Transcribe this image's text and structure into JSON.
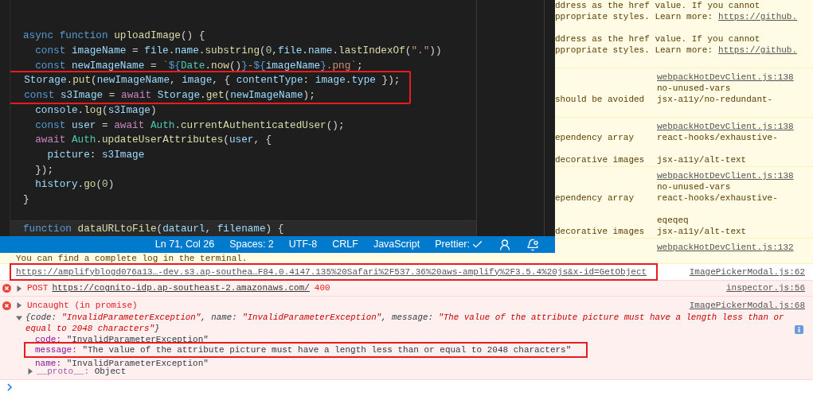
{
  "editor": {
    "lines": [
      {
        "kind": "blank",
        "highlighted": false,
        "current": false
      },
      {
        "kind": "blank",
        "highlighted": false,
        "current": false
      },
      {
        "kind": "code",
        "highlighted": false,
        "current": false,
        "tokens": [
          {
            "text": "async",
            "kind": "kw"
          },
          {
            "text": " function",
            "kind": "kw"
          },
          {
            "text": " uploadImage",
            "kind": "fn"
          },
          {
            "text": "() {",
            "kind": "plain"
          }
        ]
      },
      {
        "kind": "code",
        "highlighted": false,
        "current": false,
        "tokens": [
          {
            "text": "  const",
            "kind": "kw"
          },
          {
            "text": " imageName",
            "kind": "var"
          },
          {
            "text": " = ",
            "kind": "plain"
          },
          {
            "text": "file",
            "kind": "var"
          },
          {
            "text": ".",
            "kind": "plain"
          },
          {
            "text": "name",
            "kind": "var"
          },
          {
            "text": ".",
            "kind": "plain"
          },
          {
            "text": "substring",
            "kind": "fn"
          },
          {
            "text": "(",
            "kind": "plain"
          },
          {
            "text": "0",
            "kind": "num"
          },
          {
            "text": ",",
            "kind": "plain"
          },
          {
            "text": "file",
            "kind": "var"
          },
          {
            "text": ".",
            "kind": "plain"
          },
          {
            "text": "name",
            "kind": "var"
          },
          {
            "text": ".",
            "kind": "plain"
          },
          {
            "text": "lastIndexOf",
            "kind": "fn"
          },
          {
            "text": "(",
            "kind": "plain"
          },
          {
            "text": "\".\"",
            "kind": "str"
          },
          {
            "text": "))",
            "kind": "plain"
          }
        ]
      },
      {
        "kind": "code",
        "highlighted": false,
        "current": false,
        "tokens": [
          {
            "text": "  const",
            "kind": "kw"
          },
          {
            "text": " newImageName",
            "kind": "var"
          },
          {
            "text": " = ",
            "kind": "plain"
          },
          {
            "text": "`",
            "kind": "str"
          },
          {
            "text": "${",
            "kind": "kw"
          },
          {
            "text": "Date",
            "kind": "type"
          },
          {
            "text": ".",
            "kind": "plain"
          },
          {
            "text": "now",
            "kind": "fn"
          },
          {
            "text": "()",
            "kind": "plain"
          },
          {
            "text": "}",
            "kind": "kw"
          },
          {
            "text": "-",
            "kind": "str"
          },
          {
            "text": "${",
            "kind": "kw"
          },
          {
            "text": "imageName",
            "kind": "var"
          },
          {
            "text": "}",
            "kind": "kw"
          },
          {
            "text": ".png`",
            "kind": "str"
          },
          {
            "text": ";",
            "kind": "plain"
          }
        ]
      },
      {
        "kind": "code",
        "highlighted": true,
        "current": false,
        "tokens": [
          {
            "text": "  Storage",
            "kind": "var"
          },
          {
            "text": ".",
            "kind": "plain"
          },
          {
            "text": "put",
            "kind": "fn"
          },
          {
            "text": "(",
            "kind": "plain"
          },
          {
            "text": "newImageName",
            "kind": "var"
          },
          {
            "text": ", ",
            "kind": "plain"
          },
          {
            "text": "image",
            "kind": "var"
          },
          {
            "text": ", { ",
            "kind": "plain"
          },
          {
            "text": "contentType",
            "kind": "var"
          },
          {
            "text": ": ",
            "kind": "plain"
          },
          {
            "text": "image",
            "kind": "var"
          },
          {
            "text": ".",
            "kind": "plain"
          },
          {
            "text": "type",
            "kind": "var"
          },
          {
            "text": " });",
            "kind": "plain"
          }
        ]
      },
      {
        "kind": "code",
        "highlighted": true,
        "current": false,
        "tokens": [
          {
            "text": "  const",
            "kind": "kw"
          },
          {
            "text": " s3Image",
            "kind": "var"
          },
          {
            "text": " = ",
            "kind": "plain"
          },
          {
            "text": "await",
            "kind": "ctl"
          },
          {
            "text": " Storage",
            "kind": "var"
          },
          {
            "text": ".",
            "kind": "plain"
          },
          {
            "text": "get",
            "kind": "fn"
          },
          {
            "text": "(",
            "kind": "plain"
          },
          {
            "text": "newImageName",
            "kind": "var"
          },
          {
            "text": ");",
            "kind": "plain"
          }
        ]
      },
      {
        "kind": "code",
        "highlighted": false,
        "current": false,
        "tokens": [
          {
            "text": "  console",
            "kind": "var"
          },
          {
            "text": ".",
            "kind": "plain"
          },
          {
            "text": "log",
            "kind": "fn"
          },
          {
            "text": "(",
            "kind": "plain"
          },
          {
            "text": "s3Image",
            "kind": "var"
          },
          {
            "text": ")",
            "kind": "plain"
          }
        ]
      },
      {
        "kind": "code",
        "highlighted": false,
        "current": false,
        "tokens": [
          {
            "text": "  const",
            "kind": "kw"
          },
          {
            "text": " user",
            "kind": "var"
          },
          {
            "text": " = ",
            "kind": "plain"
          },
          {
            "text": "await",
            "kind": "ctl"
          },
          {
            "text": " Auth",
            "kind": "type"
          },
          {
            "text": ".",
            "kind": "plain"
          },
          {
            "text": "currentAuthenticatedUser",
            "kind": "fn"
          },
          {
            "text": "();",
            "kind": "plain"
          }
        ]
      },
      {
        "kind": "code",
        "highlighted": false,
        "current": false,
        "tokens": [
          {
            "text": "  await",
            "kind": "ctl"
          },
          {
            "text": " Auth",
            "kind": "type"
          },
          {
            "text": ".",
            "kind": "plain"
          },
          {
            "text": "updateUserAttributes",
            "kind": "fn"
          },
          {
            "text": "(",
            "kind": "plain"
          },
          {
            "text": "user",
            "kind": "var"
          },
          {
            "text": ", {",
            "kind": "plain"
          }
        ]
      },
      {
        "kind": "code",
        "highlighted": false,
        "current": false,
        "tokens": [
          {
            "text": "    picture",
            "kind": "var"
          },
          {
            "text": ": ",
            "kind": "plain"
          },
          {
            "text": "s3Image",
            "kind": "var"
          }
        ]
      },
      {
        "kind": "code",
        "highlighted": false,
        "current": false,
        "tokens": [
          {
            "text": "  });",
            "kind": "plain"
          }
        ]
      },
      {
        "kind": "code",
        "highlighted": false,
        "current": false,
        "tokens": [
          {
            "text": "  history",
            "kind": "var"
          },
          {
            "text": ".",
            "kind": "plain"
          },
          {
            "text": "go",
            "kind": "fn"
          },
          {
            "text": "(",
            "kind": "plain"
          },
          {
            "text": "0",
            "kind": "num"
          },
          {
            "text": ")",
            "kind": "plain"
          }
        ]
      },
      {
        "kind": "code",
        "highlighted": false,
        "current": false,
        "tokens": [
          {
            "text": "}",
            "kind": "plain"
          }
        ]
      },
      {
        "kind": "blank",
        "highlighted": false,
        "current": false
      },
      {
        "kind": "code",
        "highlighted": false,
        "current": true,
        "tokens": [
          {
            "text": "function",
            "kind": "kw"
          },
          {
            "text": " dataURLtoFile",
            "kind": "fn"
          },
          {
            "text": "(",
            "kind": "plain"
          },
          {
            "text": "dataurl",
            "kind": "var"
          },
          {
            "text": ", ",
            "kind": "plain"
          },
          {
            "text": "filename",
            "kind": "var"
          },
          {
            "text": ") {",
            "kind": "plain"
          }
        ]
      }
    ],
    "status_bar": [
      {
        "kind": "text",
        "text": "Ln 71, Col 26"
      },
      {
        "kind": "text",
        "text": "Spaces: 2"
      },
      {
        "kind": "text",
        "text": "UTF-8"
      },
      {
        "kind": "text",
        "text": "CRLF"
      },
      {
        "kind": "text",
        "text": "JavaScript"
      },
      {
        "kind": "checked",
        "text": "Prettier:"
      },
      {
        "kind": "feedback"
      },
      {
        "kind": "notifications"
      }
    ]
  },
  "console": {
    "side_rows": [
      {
        "lines": [
          {
            "message": "ddress as the href value. If you cannot",
            "blank_after": false
          },
          {
            "message": "ppropriate styles. Learn more:",
            "link": "https://github.",
            "blank_after": true
          },
          {
            "message": "ddress as the href value. If you cannot",
            "blank_after": false
          },
          {
            "message": "ppropriate styles. Learn more:",
            "link": "https://github.",
            "blank_after": true
          }
        ]
      },
      {
        "source": "webpackHotDevClient.js:138",
        "lines": [
          {
            "rule": "no-unused-vars",
            "blank_after": false
          },
          {
            "message": "should be avoided",
            "rule": "jsx-a11y/no-redundant-",
            "blank_after": true
          }
        ]
      },
      {
        "source": "webpackHotDevClient.js:138",
        "lines": [
          {
            "message": "ependency array",
            "rule": "react-hooks/exhaustive-",
            "blank_after": true
          },
          {
            "message": "decorative images",
            "rule": "jsx-a11y/alt-text",
            "blank_after": false
          }
        ]
      },
      {
        "source": "webpackHotDevClient.js:138",
        "lines": [
          {
            "rule": "no-unused-vars",
            "blank_after": false
          },
          {
            "message": "ependency array",
            "rule": "react-hooks/exhaustive-",
            "blank_after": true
          },
          {
            "rule": "eqeqeq",
            "blank_after": false
          },
          {
            "message": "decorative images",
            "rule": "jsx-a11y/alt-text",
            "blank_after": false
          }
        ]
      },
      {
        "source": "webpackHotDevClient.js:132"
      }
    ],
    "rows": [
      {
        "kind": "info",
        "message": "You can find a complete log in the terminal."
      },
      {
        "kind": "log",
        "link": "https://amplifyblogd076a13…-dev.s3.ap-southea…F84.0.4147.135%20Safari%2F537.36%20aws-amplify%2F3.5.4%20js&x-id=GetObject",
        "source": "ImagePickerModal.js:62",
        "highlighted": true
      },
      {
        "kind": "request_error",
        "expanded": false,
        "method": "POST",
        "link": "https://cognito-idp.ap-southeast-2.amazonaws.com/",
        "status": "400",
        "source": "inspector.js:56"
      },
      {
        "kind": "error",
        "expanded": false,
        "title": "Uncaught (in promise)",
        "source": "ImagePickerModal.js:68",
        "preview_expanded": true,
        "preview": [
          {
            "text": "{code: ",
            "kind": "key"
          },
          {
            "text": "\"InvalidParameterException\"",
            "kind": "string"
          },
          {
            "text": ", name: ",
            "kind": "key"
          },
          {
            "text": "\"InvalidParameterException\"",
            "kind": "string"
          },
          {
            "text": ", message: ",
            "kind": "key"
          },
          {
            "text": "\"The value of the attribute picture must have a length less than or equal to 2048 characters\"",
            "kind": "string"
          },
          {
            "text": "}",
            "kind": "key"
          }
        ],
        "properties": [
          {
            "key": "code:",
            "value": "\"InvalidParameterException\"",
            "highlighted": false
          },
          {
            "key": "message:",
            "value": "\"The value of the attribute picture must have a length less than or equal to 2048 characters\"",
            "highlighted": true
          },
          {
            "key": "name:",
            "value": "\"InvalidParameterException\"",
            "highlighted": false
          }
        ],
        "proto": {
          "key": "__proto__:",
          "value": "Object",
          "expanded": false
        }
      }
    ]
  }
}
